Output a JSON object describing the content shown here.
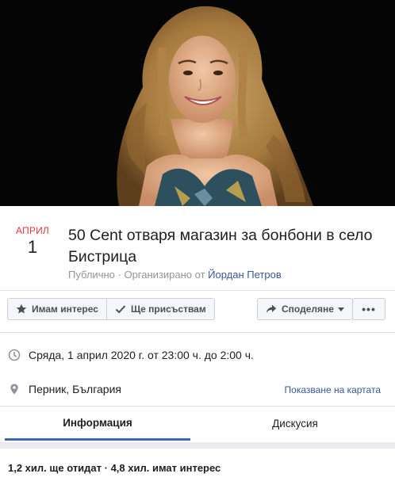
{
  "event": {
    "month": "АПРИЛ",
    "day": "1",
    "title": "50 Cent отваря магазин за бонбони в село Бистрица",
    "privacy": "Публично",
    "organized_by_prefix": "Организирано от",
    "organizer": "Йордан Петров"
  },
  "actions": {
    "interested_label": "Имам интерес",
    "going_label": "Ще присъствам",
    "share_label": "Споделяне",
    "more_label": "•••"
  },
  "details": {
    "datetime": "Сряда, 1 април 2020 г. от 23:00 ч. до 2:00 ч.",
    "location": "Перник, България",
    "map_link": "Показване на картата"
  },
  "tabs": [
    {
      "label": "Информация",
      "active": true
    },
    {
      "label": "Дискусия",
      "active": false
    }
  ],
  "stats": {
    "text": "1,2 хил. ще отидат · 4,8 хил. имат интерес"
  },
  "colors": {
    "accent": "#4267b2",
    "month_red": "#e0393e",
    "link_blue": "#385898"
  },
  "icons": [
    "star-icon",
    "check-icon",
    "share-arrow-icon",
    "clock-icon",
    "location-pin-icon"
  ]
}
